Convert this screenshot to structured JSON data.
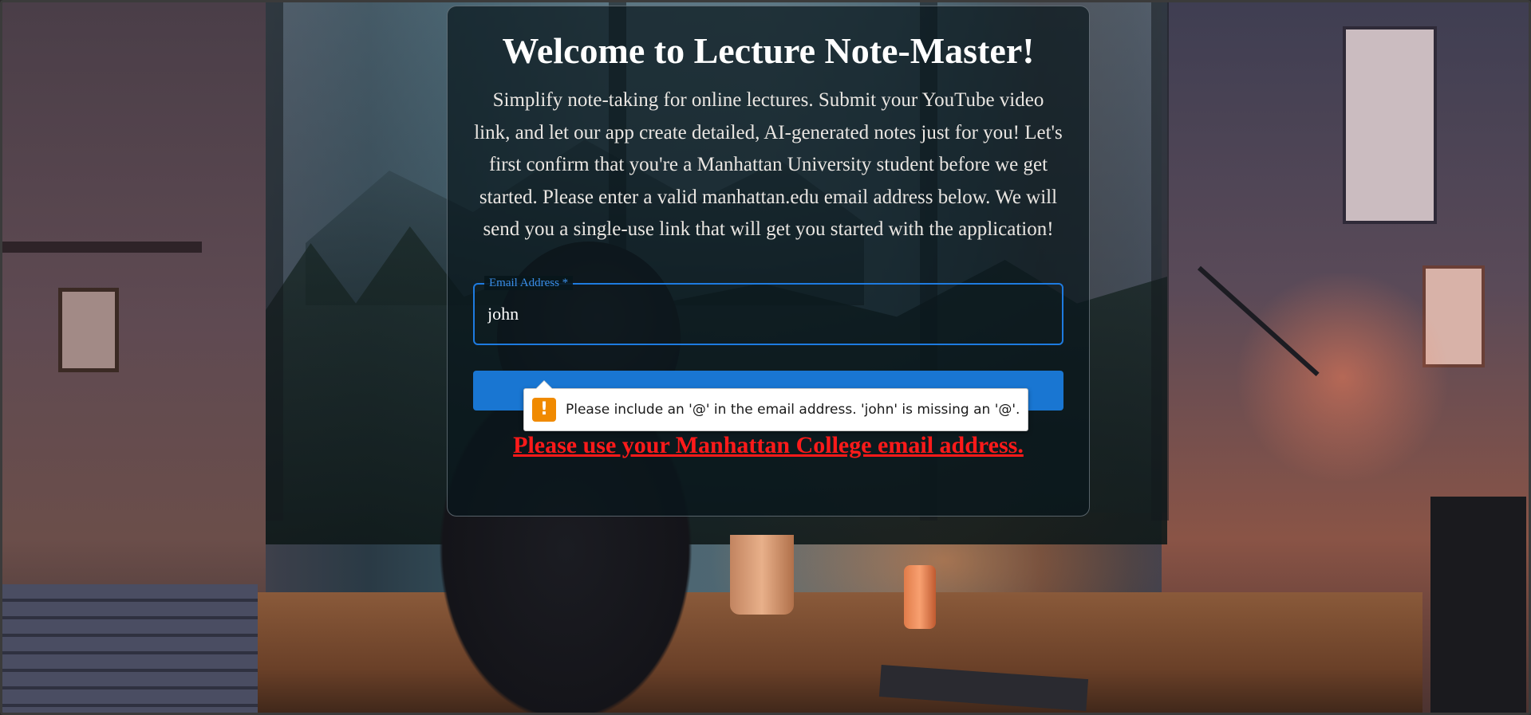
{
  "hero": {
    "title": "Welcome to Lecture Note-Master!",
    "description": "Simplify note-taking for online lectures. Submit your YouTube video link, and let our app create detailed, AI-generated notes just for you! Let's first confirm that you're a Manhattan University student before we get started. Please enter a valid manhattan.edu email address below. We will send you a single-use link that will get you started with the application!"
  },
  "form": {
    "email_label": "Email Address *",
    "email_value": "john",
    "submit_label": "",
    "warning_text": "Please use your Manhattan College email address."
  },
  "validation_tooltip": {
    "icon": "warning-icon",
    "icon_glyph": "!",
    "message": "Please include an '@' in the email address. 'john' is missing an '@'."
  },
  "colors": {
    "accent": "#1976d2",
    "warning_text": "#ff1a1a",
    "tooltip_icon": "#f08a00"
  }
}
